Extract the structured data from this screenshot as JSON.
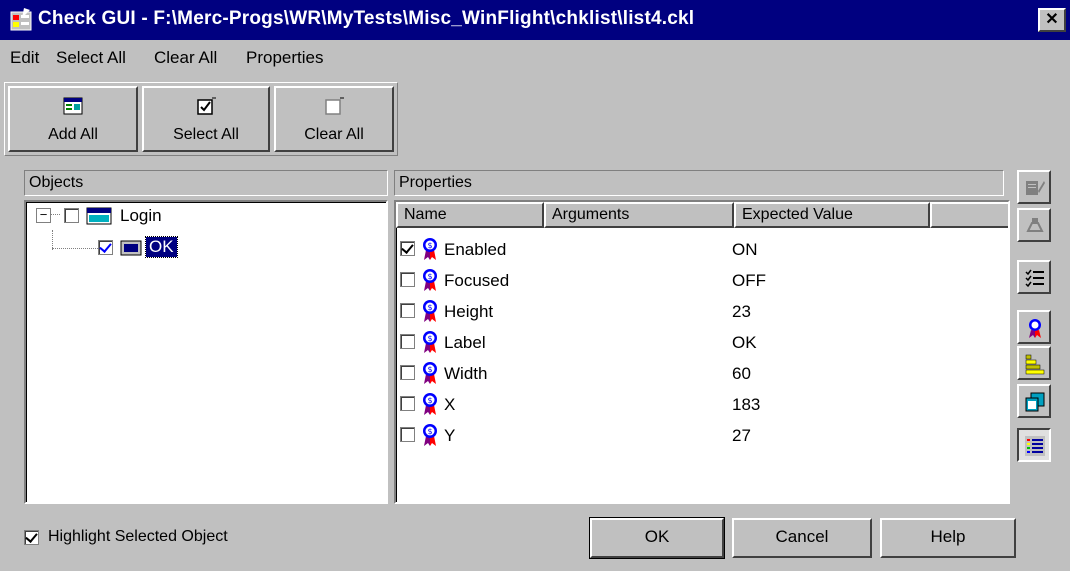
{
  "window": {
    "title": "Check GUI - F:\\Merc-Progs\\WR\\MyTests\\Misc_WinFlight\\chklist\\list4.ckl",
    "close_label": "✕"
  },
  "menu": {
    "edit": "Edit",
    "select_all": "Select All",
    "clear_all": "Clear All",
    "properties": "Properties"
  },
  "toolbar": {
    "add_all": "Add All",
    "select_all": "Select All",
    "clear_all": "Clear All"
  },
  "objects_panel": {
    "header": "Objects",
    "tree": [
      {
        "label": "Login",
        "checked": false,
        "icon": "window-icon"
      },
      {
        "label": "OK",
        "checked": true,
        "selected": true,
        "icon": "push-button-icon"
      }
    ]
  },
  "properties_panel": {
    "header": "Properties",
    "columns": [
      "Name",
      "Arguments",
      "Expected Value",
      ""
    ],
    "rows": [
      {
        "name": "Enabled",
        "arguments": "",
        "expected": "ON",
        "checked": true
      },
      {
        "name": "Focused",
        "arguments": "",
        "expected": "OFF",
        "checked": false
      },
      {
        "name": "Height",
        "arguments": "",
        "expected": "23",
        "checked": false
      },
      {
        "name": "Label",
        "arguments": "",
        "expected": "OK",
        "checked": false
      },
      {
        "name": "Width",
        "arguments": "",
        "expected": "60",
        "checked": false
      },
      {
        "name": "X",
        "arguments": "",
        "expected": "183",
        "checked": false
      },
      {
        "name": "Y",
        "arguments": "",
        "expected": "27",
        "checked": false
      }
    ]
  },
  "side_toolbar": [
    {
      "icon": "edit-expected-value-icon",
      "enabled": false
    },
    {
      "icon": "specify-arguments-icon",
      "enabled": false
    },
    {
      "icon": "checklist-icon",
      "enabled": true
    },
    {
      "icon": "property-ribbon-icon",
      "enabled": true
    },
    {
      "icon": "stairs-icon",
      "enabled": true
    },
    {
      "icon": "copy-object-icon",
      "enabled": true
    },
    {
      "icon": "list-view-icon",
      "enabled": true,
      "pressed": true
    }
  ],
  "footer": {
    "highlight_label": "Highlight Selected Object",
    "highlight_checked": true,
    "ok": "OK",
    "cancel": "Cancel",
    "help": "Help"
  }
}
